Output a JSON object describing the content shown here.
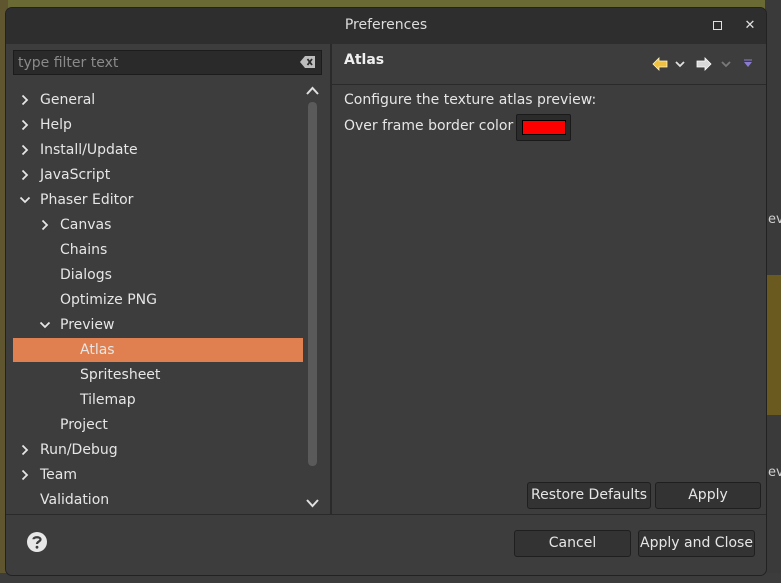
{
  "window": {
    "title": "Preferences"
  },
  "filter": {
    "placeholder": "type filter text",
    "value": ""
  },
  "tree": {
    "items": [
      {
        "label": "General",
        "level": 0,
        "expander": "collapsed"
      },
      {
        "label": "Help",
        "level": 0,
        "expander": "collapsed"
      },
      {
        "label": "Install/Update",
        "level": 0,
        "expander": "collapsed"
      },
      {
        "label": "JavaScript",
        "level": 0,
        "expander": "collapsed"
      },
      {
        "label": "Phaser Editor",
        "level": 0,
        "expander": "expanded"
      },
      {
        "label": "Canvas",
        "level": 1,
        "expander": "collapsed"
      },
      {
        "label": "Chains",
        "level": 1,
        "expander": "none"
      },
      {
        "label": "Dialogs",
        "level": 1,
        "expander": "none"
      },
      {
        "label": "Optimize PNG",
        "level": 1,
        "expander": "none"
      },
      {
        "label": "Preview",
        "level": 1,
        "expander": "expanded"
      },
      {
        "label": "Atlas",
        "level": 2,
        "expander": "none",
        "selected": true
      },
      {
        "label": "Spritesheet",
        "level": 2,
        "expander": "none"
      },
      {
        "label": "Tilemap",
        "level": 2,
        "expander": "none"
      },
      {
        "label": "Project",
        "level": 1,
        "expander": "none"
      },
      {
        "label": "Run/Debug",
        "level": 0,
        "expander": "collapsed"
      },
      {
        "label": "Team",
        "level": 0,
        "expander": "collapsed"
      },
      {
        "label": "Validation",
        "level": 0,
        "expander": "none"
      },
      {
        "label": "",
        "level": 0,
        "expander": "collapsed"
      }
    ]
  },
  "page": {
    "title": "Atlas",
    "description": "Configure the texture atlas preview:",
    "border_color_label": "Over frame border color",
    "border_color": "#ff0000"
  },
  "buttons": {
    "restore_defaults": "Restore Defaults",
    "apply": "Apply",
    "cancel": "Cancel",
    "apply_and_close": "Apply and Close"
  },
  "colors": {
    "selection": "#e08050",
    "dialog_bg": "#3d3d3d",
    "titlebar_bg": "#2e2e2e",
    "nav_arrow": "#f0c040",
    "menu_arrow": "#8a7ad0"
  },
  "icons": {
    "back": "arrow-left-icon",
    "forward": "arrow-right-icon",
    "menu": "view-menu-icon",
    "help": "help-icon",
    "clear": "clear-filter-icon"
  }
}
